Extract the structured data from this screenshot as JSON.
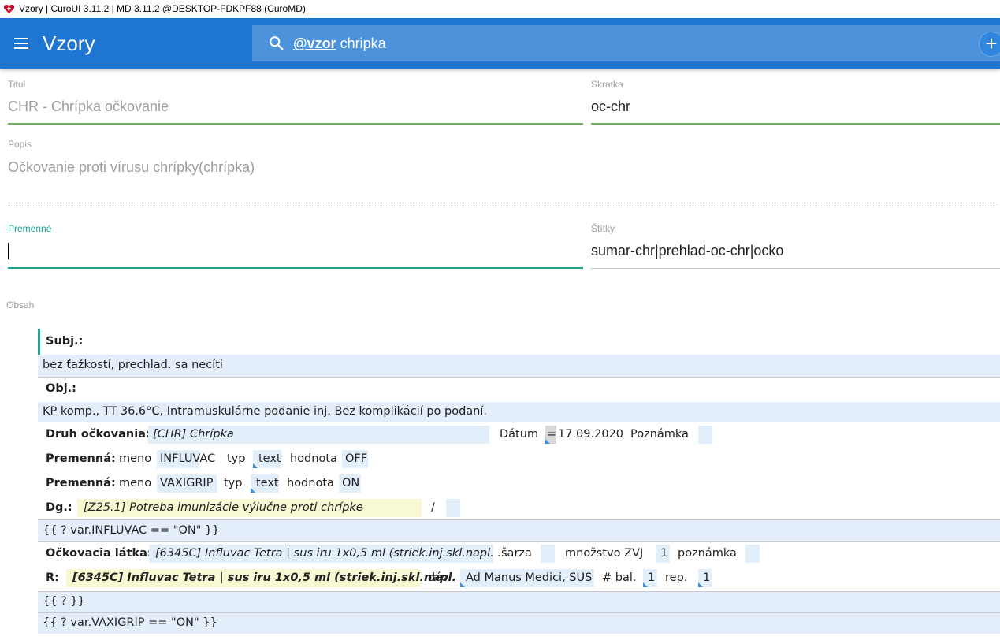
{
  "window": {
    "title": "Vzory | CuroUI 3.11.2 | MD 3.11.2 @DESKTOP-FDKPF88 (CuroMD)"
  },
  "appbar": {
    "title": "Vzory",
    "search": {
      "token": "@vzor",
      "query": "chripka"
    },
    "add_label": "+"
  },
  "form": {
    "titul": {
      "label": "Titul",
      "value": "CHR - Chrípka očkovanie"
    },
    "skratka": {
      "label": "Skratka",
      "value": "oc-chr"
    },
    "popis": {
      "label": "Popis",
      "value": "Očkovanie proti vírusu chrípky(chrípka)"
    },
    "premenne": {
      "label": "Premenné",
      "value": ""
    },
    "stitky": {
      "label": "Štítky",
      "value": "sumar-chr|prehlad-oc-chr|ocko"
    },
    "obsah": {
      "label": "Obsah"
    }
  },
  "editor": {
    "subj": {
      "label": "Subj.:",
      "text": "bez ťažkostí, prechlad. sa necíti"
    },
    "obj": {
      "label": "Obj.:",
      "text": "KP komp., TT 36,6°C, Intramuskulárne podanie inj. Bez komplikácií po podaní."
    },
    "druh": {
      "label": "Druh očkovania:",
      "value": "[CHR] Chrípka",
      "datum_label": "Dátum",
      "datum_eq": "=",
      "datum_value": "17.09.2020",
      "poznamka_label": "Poznámka"
    },
    "var1": {
      "label": "Premenná:",
      "meno_label": "meno",
      "meno": "INFLUVAC",
      "typ_label": "typ",
      "typ": "text",
      "hodnota_label": "hodnota",
      "hodnota": "OFF"
    },
    "var2": {
      "label": "Premenná:",
      "meno_label": "meno",
      "meno": "VAXIGRIP",
      "typ_label": "typ",
      "typ": "text",
      "hodnota_label": "hodnota",
      "hodnota": "ON"
    },
    "dg": {
      "label": "Dg.:",
      "value": "[Z25.1] Potreba imunizácie výlučne proti chrípke",
      "slash": "/"
    },
    "cond1": "{{ ? var.INFLUVAC == \"ON\" }}",
    "latka": {
      "label": "Očkovacia látka:",
      "value": "[6345C] Influvac Tetra | sus iru 1x0,5 ml (striek.inj.skl.napl. ...",
      "sarza_label": "šarza",
      "mnozstvo_label": "množstvo ZVJ",
      "mnozstvo": "1",
      "poznamka_label": "poznámka"
    },
    "r": {
      "label": "R:",
      "value": "[6345C] Influvac Tetra | sus iru 1x0,5 ml (striek.inj.skl.napl. ...",
      "dav_label": "dáv.",
      "dav": "Ad Manus Medici, SUS",
      "bal_label": "# bal.",
      "bal": "1",
      "rep_label": "rep.",
      "rep": "1"
    },
    "cond_end": "{{ ? }}",
    "cond2": "{{ ? var.VAXIGRIP == \"ON\" }}"
  },
  "colors": {
    "appbar": "#1e76d2",
    "search_bg": "#4c93dc",
    "valid_line": "#6ab35a",
    "focus_line": "#1aa38f",
    "field_bg": "#e2eefa",
    "dg_bg": "#f8f8d2"
  },
  "icons": [
    "app-logo-icon",
    "menu-icon",
    "search-icon",
    "add-icon"
  ]
}
